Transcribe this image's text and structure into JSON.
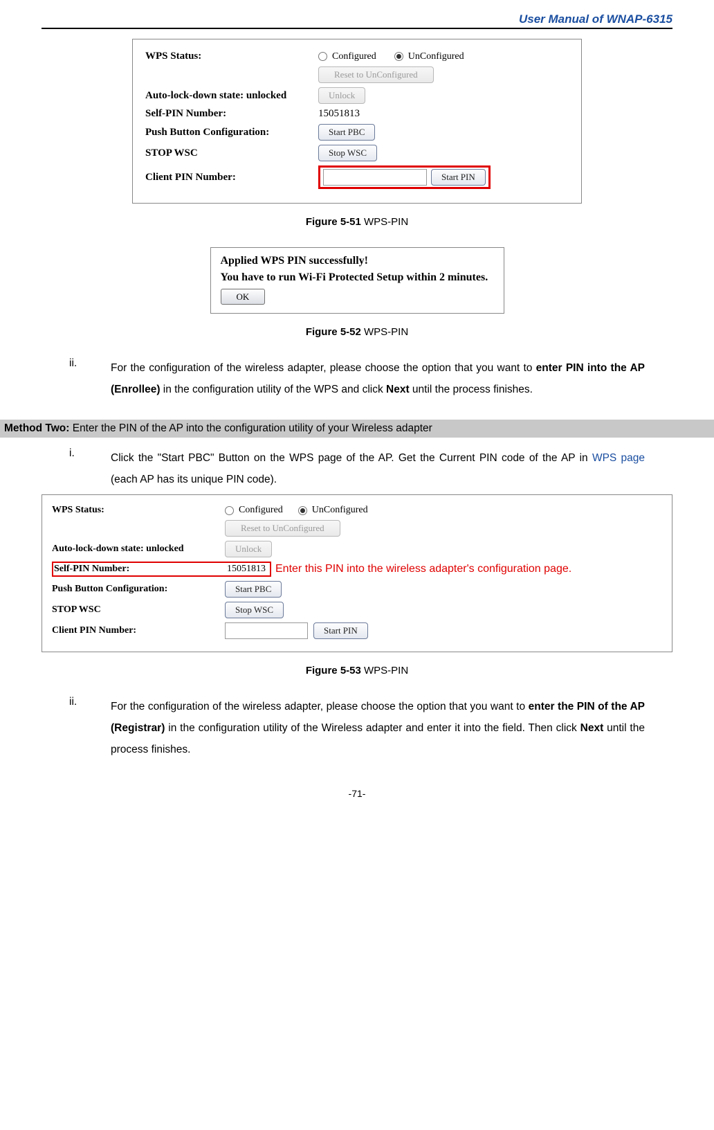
{
  "header": {
    "title": "User Manual of WNAP-6315"
  },
  "fig51": {
    "wps_status_label": "WPS Status:",
    "radio_configured": "Configured",
    "radio_unconfigured": "UnConfigured",
    "reset_btn": "Reset to UnConfigured",
    "autolock_label": "Auto-lock-down state: unlocked",
    "unlock_btn": "Unlock",
    "selfpin_label": "Self-PIN Number:",
    "selfpin_value": "15051813",
    "pbc_label": "Push Button Configuration:",
    "pbc_btn": "Start PBC",
    "stopwsc_label": "STOP WSC",
    "stopwsc_btn": "Stop WSC",
    "clientpin_label": "Client PIN Number:",
    "startpin_btn": "Start PIN"
  },
  "caption51": {
    "bold": "Figure 5-51",
    "rest": " WPS-PIN"
  },
  "dialog52": {
    "line1": "Applied WPS PIN successfully!",
    "line2": "You have to run Wi-Fi Protected Setup within 2 minutes.",
    "ok": "OK"
  },
  "caption52": {
    "bold": "Figure 5-52",
    "rest": " WPS-PIN"
  },
  "para_ii_1": {
    "roman": "ii.",
    "pre": "For the configuration of the wireless adapter, please choose the option that you want to ",
    "b1": "enter PIN into the AP (Enrollee)",
    "mid": " in the configuration utility of the WPS and click ",
    "b2": "Next",
    "post": " until the process finishes."
  },
  "method2": {
    "bold": "Method Two:",
    "rest": " Enter the PIN of the AP into the configuration utility of your Wireless adapter"
  },
  "para_i_2": {
    "roman": "i.",
    "pre": "Click the \"Start PBC\" Button on the WPS page of the AP. Get the Current PIN code of the AP in ",
    "link": "WPS page",
    "post": " (each AP has its unique PIN code)."
  },
  "fig53": {
    "wps_status_label": "WPS Status:",
    "radio_configured": "Configured",
    "radio_unconfigured": "UnConfigured",
    "reset_btn": "Reset to UnConfigured",
    "autolock_label": "Auto-lock-down state: unlocked",
    "unlock_btn": "Unlock",
    "selfpin_label": "Self-PIN Number:",
    "selfpin_value": "15051813",
    "annotation": "Enter this PIN into the wireless adapter's configuration page.",
    "pbc_label": "Push Button Configuration:",
    "pbc_btn": "Start PBC",
    "stopwsc_label": "STOP WSC",
    "stopwsc_btn": "Stop WSC",
    "clientpin_label": "Client PIN Number:",
    "startpin_btn": "Start PIN"
  },
  "caption53": {
    "bold": "Figure 5-53",
    "rest": " WPS-PIN"
  },
  "para_ii_2": {
    "roman": "ii.",
    "pre": "For the configuration of the wireless adapter, please choose the option that you want to ",
    "b1": "enter the PIN of the AP (Registrar)",
    "mid": " in the configuration utility of the Wireless adapter and enter it into the field. Then click ",
    "b2": "Next",
    "post": " until the process finishes."
  },
  "pagenum": "-71-"
}
